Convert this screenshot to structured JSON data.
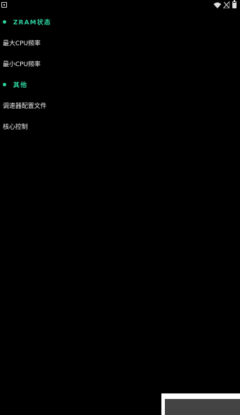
{
  "status_bar": {
    "icons": [
      "app-notification-icon",
      "wifi-icon",
      "no-sim-signal-icon",
      "battery-icon"
    ]
  },
  "sections": [
    {
      "title": "ZRAM状态",
      "items": [
        {
          "label": "最大CPU频率"
        },
        {
          "label": "最小CPU频率"
        }
      ]
    },
    {
      "title": "其他",
      "items": [
        {
          "label": "调速器配置文件"
        },
        {
          "label": "核心控制"
        }
      ]
    }
  ],
  "colors": {
    "background": "#000000",
    "accent": "#2fd3a0",
    "text": "#f2f2f2",
    "panel": "#444444"
  }
}
